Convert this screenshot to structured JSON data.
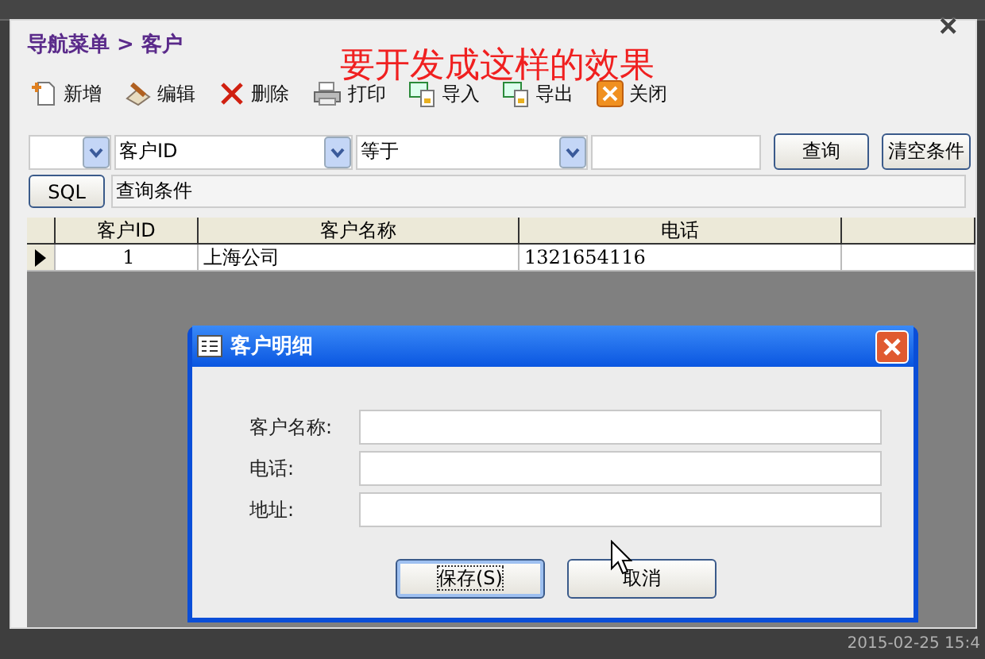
{
  "breadcrumb": "导航菜单 > 客户",
  "annotation": "要开发成这样的效果",
  "window_close": "×",
  "toolbar": [
    {
      "kind": "add",
      "label": "新增"
    },
    {
      "kind": "edit",
      "label": "编辑"
    },
    {
      "kind": "delete",
      "label": "删除"
    },
    {
      "kind": "print",
      "label": "打印"
    },
    {
      "kind": "import",
      "label": "导入"
    },
    {
      "kind": "export",
      "label": "导出"
    },
    {
      "kind": "close",
      "label": "关闭"
    }
  ],
  "query": {
    "selects": [
      {
        "kind": "blank"
      },
      {
        "kind": "text",
        "value": "客户ID"
      },
      {
        "kind": "text",
        "value": "等于"
      }
    ],
    "search_button": "查询",
    "clear_button": "清空条件",
    "sql_button": "SQL",
    "condition": "查询条件"
  },
  "table": {
    "columns": [
      "客户ID",
      "客户名称",
      "电话"
    ],
    "rows": [
      {
        "selected": true,
        "cells": [
          "1",
          "上海公司",
          "1321654116"
        ]
      }
    ]
  },
  "dialog": {
    "title": "客户明细",
    "fields": [
      {
        "label": "客户名称:"
      },
      {
        "label": "电话:"
      },
      {
        "label": "地址:"
      }
    ],
    "buttons": [
      {
        "label": "保存(S)",
        "focused": true
      },
      {
        "label": "取消",
        "focused": false
      }
    ]
  },
  "status_time": "2015-02-25 15:4"
}
